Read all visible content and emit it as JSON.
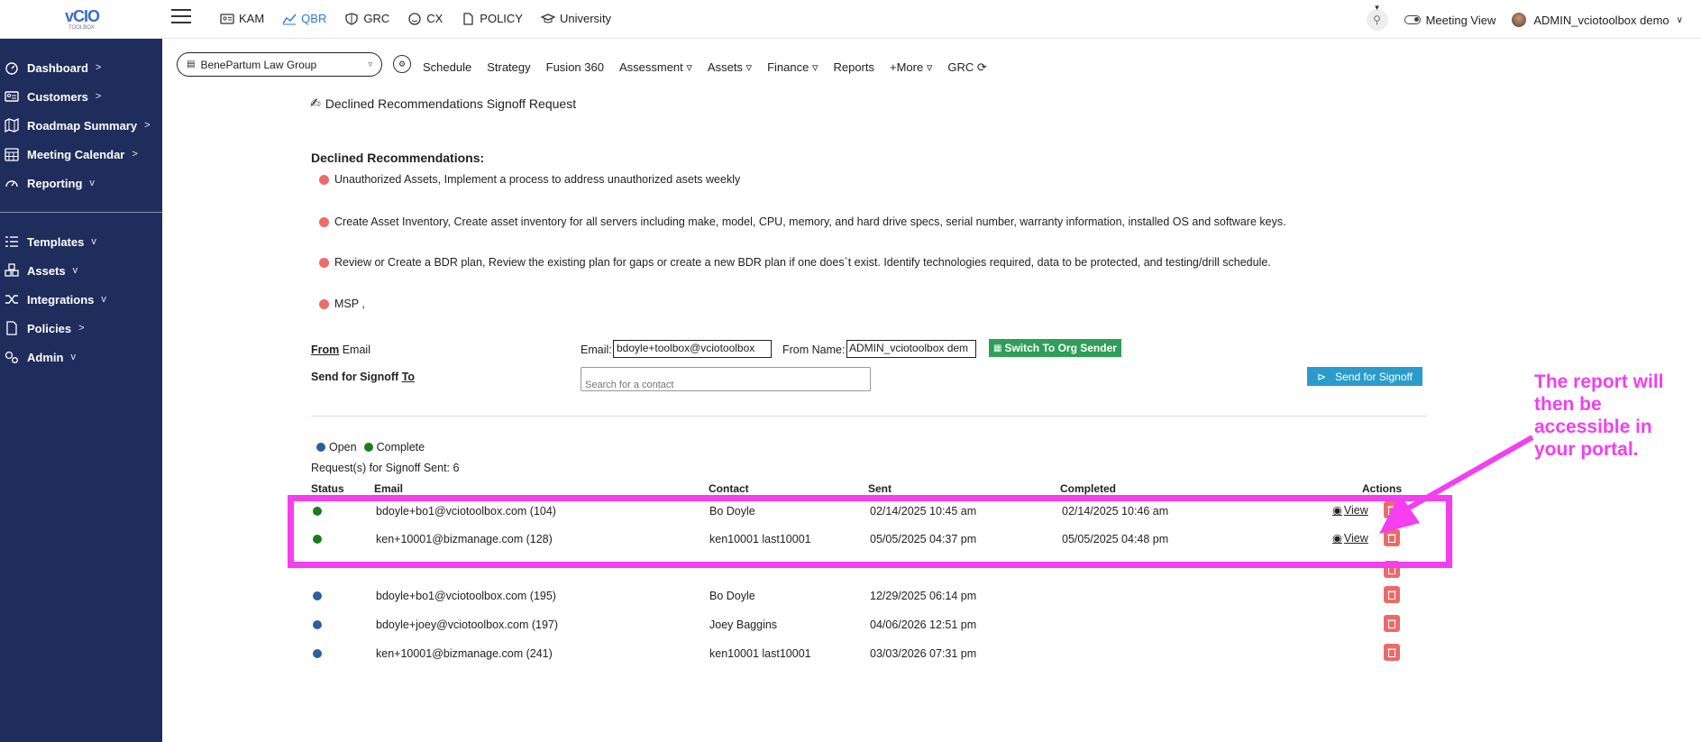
{
  "header": {
    "logo_text": "vCIO",
    "logo_sub": "TOOLBOX",
    "nav": [
      {
        "label": "KAM",
        "icon": "id-card-icon"
      },
      {
        "label": "QBR",
        "icon": "line-chart-icon",
        "active": true
      },
      {
        "label": "GRC",
        "icon": "shield-icon"
      },
      {
        "label": "CX",
        "icon": "smiley-icon"
      },
      {
        "label": "POLICY",
        "icon": "document-icon"
      },
      {
        "label": "University",
        "icon": "graduation-cap-icon"
      }
    ],
    "meeting_view_label": "Meeting View",
    "user_name": "ADMIN_vciotoolbox demo"
  },
  "sidebar": {
    "items": [
      {
        "label": "Dashboard",
        "arrow": ">"
      },
      {
        "label": "Customers",
        "arrow": ">"
      },
      {
        "label": "Roadmap Summary",
        "arrow": ">"
      },
      {
        "label": "Meeting Calendar",
        "arrow": ">"
      },
      {
        "label": "Reporting",
        "arrow": "v"
      },
      {
        "label": "Templates",
        "arrow": "v"
      },
      {
        "label": "Assets",
        "arrow": "v"
      },
      {
        "label": "Integrations",
        "arrow": "v"
      },
      {
        "label": "Policies",
        "arrow": ">"
      },
      {
        "label": "Admin",
        "arrow": "v"
      }
    ]
  },
  "org_select": {
    "value": "BenePartum Law Group"
  },
  "subnav": [
    "Schedule",
    "Strategy",
    "Fusion 360",
    "Assessment ▿",
    "Assets ▿",
    "Finance ▿",
    "Reports",
    "+More ▿",
    "GRC ⟳"
  ],
  "page": {
    "title": "Declined Recommendations Signoff Request",
    "declined_heading": "Declined Recommendations:",
    "recommendations": [
      "Unauthorized Assets, Implement a process to address unauthorized asets weekly",
      "Create Asset Inventory, Create asset inventory for all servers including make, model, CPU, memory, and hard drive specs, serial number, warranty information, installed OS and software keys.",
      "Review or Create a BDR plan, Review the existing plan for gaps or create a new BDR plan if one does`t exist. Identify technologies required, data to be protected, and testing/drill schedule.",
      "MSP ,"
    ]
  },
  "form": {
    "from_label_bold": "From",
    "from_label_rest": " Email",
    "email_label": "Email:",
    "email_value": "bdoyle+toolbox@vciotoolbox",
    "from_name_label": "From Name:",
    "from_name_value": "ADMIN_vciotoolbox dem",
    "switch_button": "Switch To Org Sender",
    "send_to_label_a": "Send for Signoff ",
    "send_to_label_b": "To",
    "contact_placeholder": "Search for a contact",
    "send_button": "Send for Signoff"
  },
  "legend": {
    "open_label": "Open",
    "complete_label": "Complete",
    "open_color": "#2d5f9e",
    "complete_color": "#1a7d1a"
  },
  "requests": {
    "count_label": "Request(s) for Signoff Sent: 6",
    "columns": {
      "status": "Status",
      "email": "Email",
      "contact": "Contact",
      "sent": "Sent",
      "completed": "Completed",
      "actions": "Actions"
    },
    "view_label": "View",
    "rows": [
      {
        "status": "complete",
        "email": "bdoyle+bo1@vciotoolbox.com (104)",
        "contact": "Bo Doyle",
        "sent": "02/14/2025 10:45 am",
        "completed": "02/14/2025 10:46 am",
        "view": true
      },
      {
        "status": "complete",
        "email": "ken+10001@bizmanage.com (128)",
        "contact": "ken10001 last10001",
        "sent": "05/05/2025 04:37 pm",
        "completed": "05/05/2025 04:48 pm",
        "view": true
      },
      {
        "status": "open",
        "email": "",
        "contact": "",
        "sent": "",
        "completed": "",
        "view": false
      },
      {
        "status": "open",
        "email": "bdoyle+bo1@vciotoolbox.com (195)",
        "contact": "Bo Doyle",
        "sent": "12/29/2025 06:14 pm",
        "completed": "",
        "view": false
      },
      {
        "status": "open",
        "email": "bdoyle+joey@vciotoolbox.com (197)",
        "contact": "Joey Baggins",
        "sent": "04/06/2026 12:51 pm",
        "completed": "",
        "view": false
      },
      {
        "status": "open",
        "email": "ken+10001@bizmanage.com (241)",
        "contact": "ken10001 last10001",
        "sent": "03/03/2026 07:31 pm",
        "completed": "",
        "view": false
      }
    ]
  },
  "annotation": {
    "text": "The report will then be accessible in your portal.",
    "color": "#f43ef0"
  }
}
